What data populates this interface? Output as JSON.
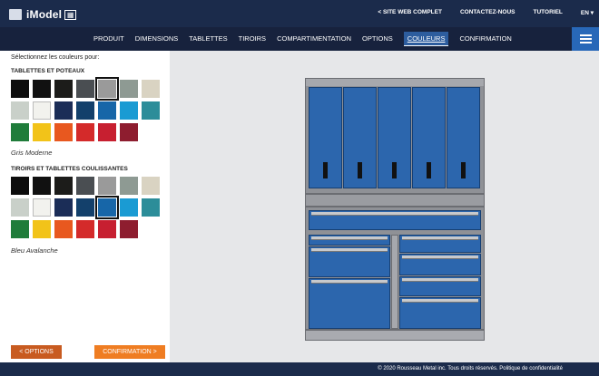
{
  "header": {
    "logo_text": "iModel",
    "links": [
      "< SITE WEB COMPLET",
      "CONTACTEZ-NOUS",
      "TUTORIEL",
      "EN ▾"
    ]
  },
  "nav": {
    "items": [
      "PRODUIT",
      "DIMENSIONS",
      "TABLETTES",
      "TIROIRS",
      "COMPARTIMENTATION",
      "OPTIONS",
      "COULEURS",
      "CONFIRMATION"
    ],
    "active": "COULEURS"
  },
  "panel": {
    "intro": "Sélectionnez les couleurs pour:",
    "section1": {
      "title": "TABLETTES ET POTEAUX",
      "selected_label": "Gris Moderne",
      "selected_index": 4
    },
    "section2": {
      "title": "TIROIRS ET TABLETTES COULISSANTES",
      "selected_label": "Bleu Avalanche",
      "selected_index": 11
    },
    "swatch_colors": [
      "#0d0d0d",
      "#111111",
      "#1c1c1a",
      "#4a4e52",
      "#9a9a9a",
      "#8e9a93",
      "#d9d3c2",
      "#c9d0c9",
      "#f2f2ee",
      "#1b2d57",
      "#13406b",
      "#1766a8",
      "#1a9bd3",
      "#2c8d99",
      "#1f7c3a",
      "#f2c319",
      "#e8581f",
      "#d42a2a",
      "#c71f30",
      "#8e1d2f"
    ]
  },
  "buttons": {
    "back": "< OPTIONS",
    "next": "CONFIRMATION >"
  },
  "colors": {
    "header_bg": "#1b2b4b",
    "nav_bg": "#17223d",
    "accent_blue": "#2868b8",
    "btn_back": "#c85b20",
    "btn_next": "#ef7d22",
    "cabinet_blue": "#2c66ad",
    "frame_gray": "#8f9196"
  },
  "footer": {
    "text": "© 2020 Rousseau Metal inc. Tous droits réservés. Politique de confidentialité"
  }
}
